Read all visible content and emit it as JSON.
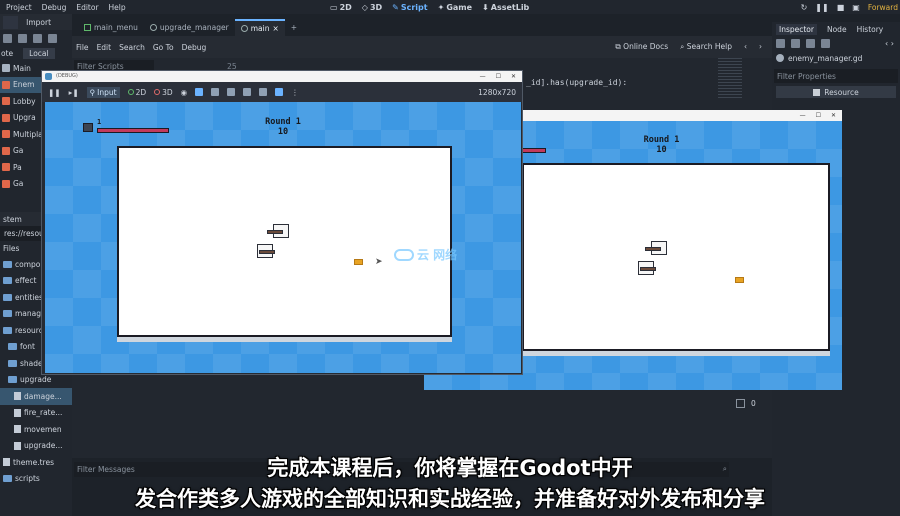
{
  "topbar": {
    "menu": [
      "Project",
      "Debug",
      "Editor",
      "Help"
    ],
    "workspaces": [
      "2D",
      "3D",
      "Script",
      "Game",
      "AssetLib"
    ],
    "active_workspace": "Script",
    "renderer": "Forward"
  },
  "left_dock": {
    "tabs": [
      "Import"
    ],
    "subtabs": [
      "ote",
      "Local"
    ],
    "scene_items": [
      {
        "label": "Main"
      },
      {
        "label": "Enem"
      },
      {
        "label": "Lobby"
      },
      {
        "label": "Upgra"
      },
      {
        "label": "Multiplaye"
      },
      {
        "label": "Ga"
      },
      {
        "label": "Pa"
      },
      {
        "label": "Ga"
      }
    ],
    "filesystem_tab": "stem",
    "path": "res://resou",
    "files_label": "Files",
    "fs_items": [
      {
        "label": "componer",
        "kind": "folder"
      },
      {
        "label": "effect",
        "kind": "folder"
      },
      {
        "label": "entities",
        "kind": "folder"
      },
      {
        "label": "manager",
        "kind": "folder"
      },
      {
        "label": "resources",
        "kind": "folder"
      },
      {
        "label": "font",
        "kind": "folder"
      },
      {
        "label": "shader",
        "kind": "folder"
      },
      {
        "label": "upgrade",
        "kind": "folder"
      },
      {
        "label": "damage...",
        "kind": "file"
      },
      {
        "label": "fire_rate...",
        "kind": "file"
      },
      {
        "label": "movemen",
        "kind": "file"
      },
      {
        "label": "upgrade...",
        "kind": "file"
      },
      {
        "label": "theme.tres",
        "kind": "file"
      },
      {
        "label": "scripts",
        "kind": "folder"
      }
    ]
  },
  "editor": {
    "tabs": [
      "main_menu",
      "upgrade_manager",
      "main"
    ],
    "active_tab": "main",
    "menu": [
      "File",
      "Edit",
      "Search",
      "Go To",
      "Debug"
    ],
    "online_docs": "Online Docs",
    "search_help": "Search Help",
    "filter_scripts": "Filter Scripts",
    "line_number": "25",
    "code_line": "_id].has(upgrade_id):",
    "filter_messages": "Filter Messages",
    "counter": "0"
  },
  "inspector": {
    "tabs": [
      "Inspector",
      "Node",
      "History"
    ],
    "file": "enemy_manager.gd",
    "filter": "Filter Properties",
    "resource": "Resource"
  },
  "game_window": {
    "title": "(DEBUG)",
    "toolbar": {
      "input": "Input",
      "mode2d": "2D",
      "mode3d": "3D",
      "resolution": "1280x720"
    },
    "round_label": "Round 1",
    "round_value": "10",
    "player_hp": "1"
  },
  "game_window2": {
    "round_label": "Round 1",
    "round_value": "10"
  },
  "watermark": "云  网络",
  "subtitles": {
    "line1": "完成本课程后，你将掌握在Godot中开",
    "line2": "发合作类多人游戏的全部知识和实战经验，并准备好对外发布和分享"
  }
}
